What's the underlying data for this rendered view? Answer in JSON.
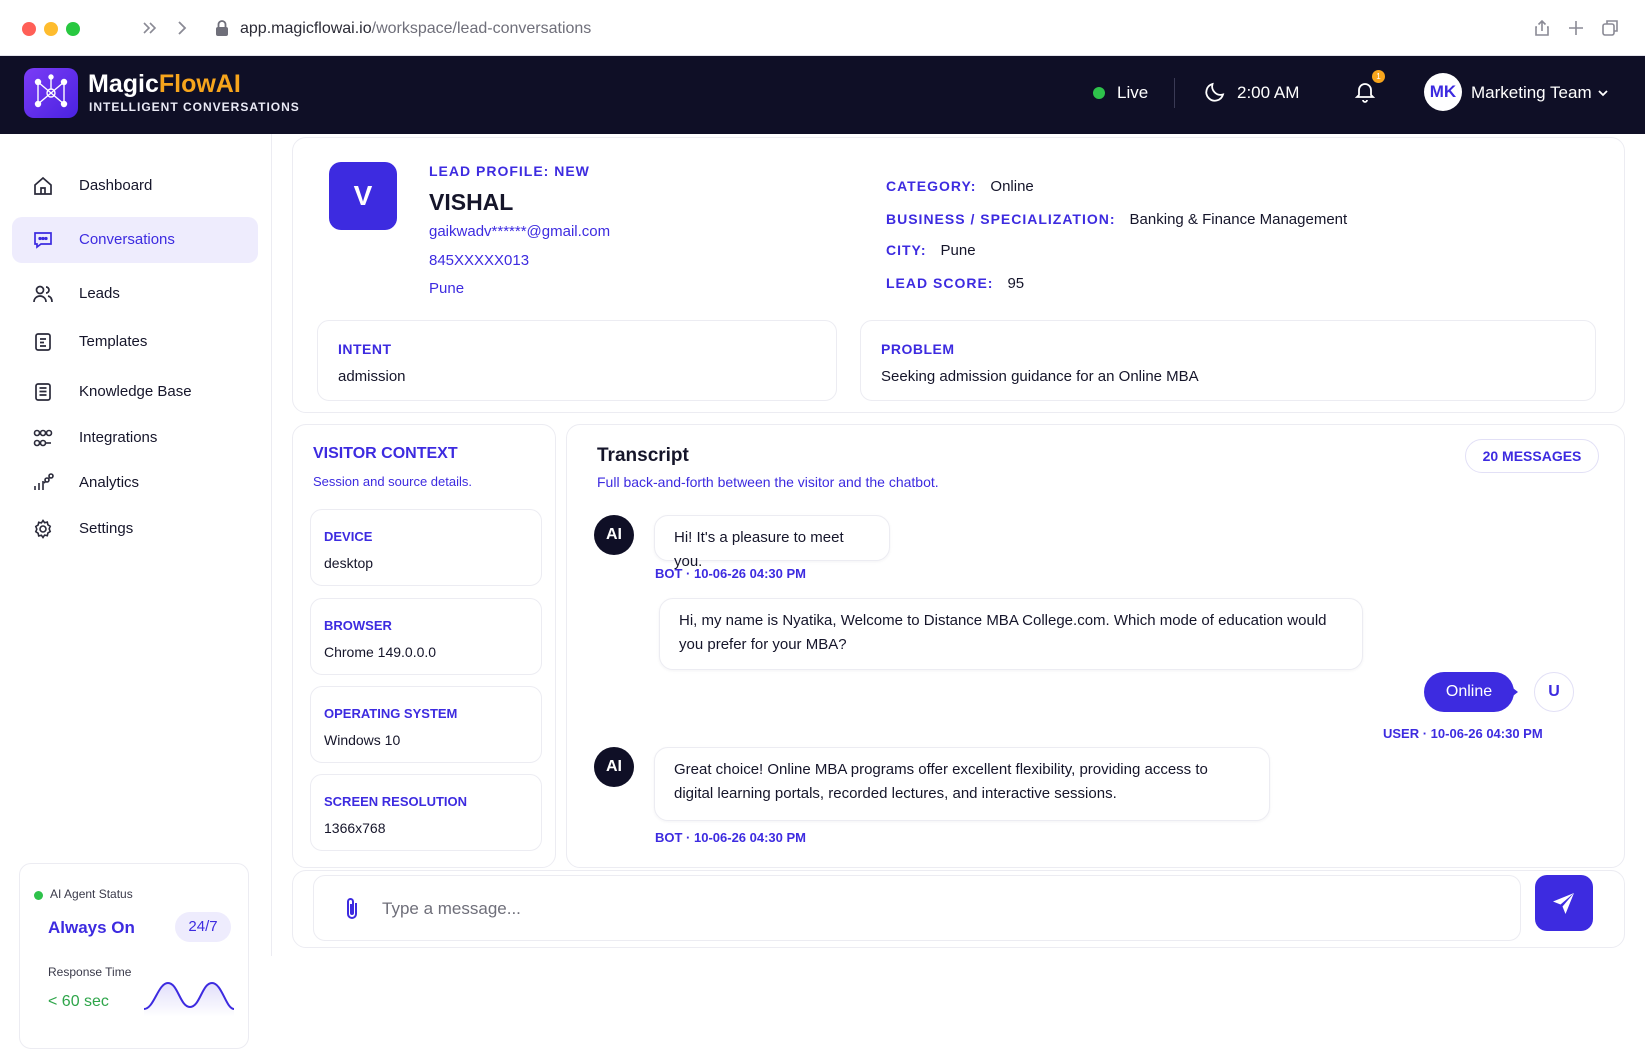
{
  "browser": {
    "url_domain": "app.magicflowai.io",
    "url_path": "/workspace/lead-conversations"
  },
  "header": {
    "brand_part1": "Magic",
    "brand_part2": "FlowAI",
    "tagline": "INTELLIGENT CONVERSATIONS",
    "live_label": "Live",
    "time": "2:00 AM",
    "notification_count": "1",
    "user_initials": "MK",
    "user_name": "Marketing Team"
  },
  "sidebar": {
    "items": [
      {
        "label": "Dashboard",
        "icon": "home-icon"
      },
      {
        "label": "Conversations",
        "icon": "chat-icon",
        "active": true
      },
      {
        "label": "Leads",
        "icon": "users-icon"
      },
      {
        "label": "Templates",
        "icon": "template-icon"
      },
      {
        "label": "Knowledge Base",
        "icon": "book-icon"
      },
      {
        "label": "Integrations",
        "icon": "integrations-icon"
      },
      {
        "label": "Analytics",
        "icon": "analytics-icon"
      },
      {
        "label": "Settings",
        "icon": "gear-icon"
      }
    ],
    "agent": {
      "status_label": "AI Agent Status",
      "status_value": "Always On",
      "badge": "24/7",
      "response_label": "Response Time",
      "response_value": "< 60 sec"
    }
  },
  "lead": {
    "initial": "V",
    "heading": "LEAD PROFILE: NEW",
    "name": "VISHAL",
    "email": "gaikwadv******@gmail.com",
    "phone": "845XXXXX013",
    "location": "Pune",
    "meta": [
      {
        "key": "CATEGORY:",
        "value": "Online"
      },
      {
        "key": "BUSINESS / SPECIALIZATION:",
        "value": "Banking & Finance Management"
      },
      {
        "key": "CITY:",
        "value": "Pune"
      },
      {
        "key": "LEAD SCORE:",
        "value": "95"
      }
    ],
    "intent_label": "INTENT",
    "intent_value": "admission",
    "problem_label": "PROBLEM",
    "problem_value": "Seeking admission guidance for an Online MBA"
  },
  "visitor": {
    "title": "VISITOR CONTEXT",
    "subtitle": "Session and source details.",
    "items": [
      {
        "label": "DEVICE",
        "value": "desktop"
      },
      {
        "label": "BROWSER",
        "value": "Chrome 149.0.0.0"
      },
      {
        "label": "OPERATING SYSTEM",
        "value": "Windows 10"
      },
      {
        "label": "SCREEN RESOLUTION",
        "value": "1366x768"
      }
    ]
  },
  "transcript": {
    "title": "Transcript",
    "subtitle": "Full back-and-forth between the visitor and the chatbot.",
    "count": "20 MESSAGES",
    "ai_initials": "AI",
    "user_initial": "U",
    "messages": [
      {
        "text": "Hi! It's a pleasure to meet you.",
        "meta": "BOT · 10-06-26 04:30 PM"
      },
      {
        "text": "Hi, my name is Nyatika, Welcome to Distance MBA College.com.  Which mode of education would you prefer for your MBA?"
      },
      {
        "text": "Online",
        "meta": "USER · 10-06-26 04:30 PM"
      },
      {
        "text": "Great choice!  Online MBA programs offer excellent flexibility, providing access to digital learning portals, recorded lectures, and interactive sessions.",
        "meta": "BOT · 10-06-26 04:30 PM"
      }
    ]
  },
  "composer": {
    "placeholder": "Type a message..."
  },
  "colors": {
    "accent": "#3d2be0",
    "dark_bar": "#0f0f26",
    "brand_orange": "#f7a51c",
    "live_green": "#2ec24b"
  }
}
